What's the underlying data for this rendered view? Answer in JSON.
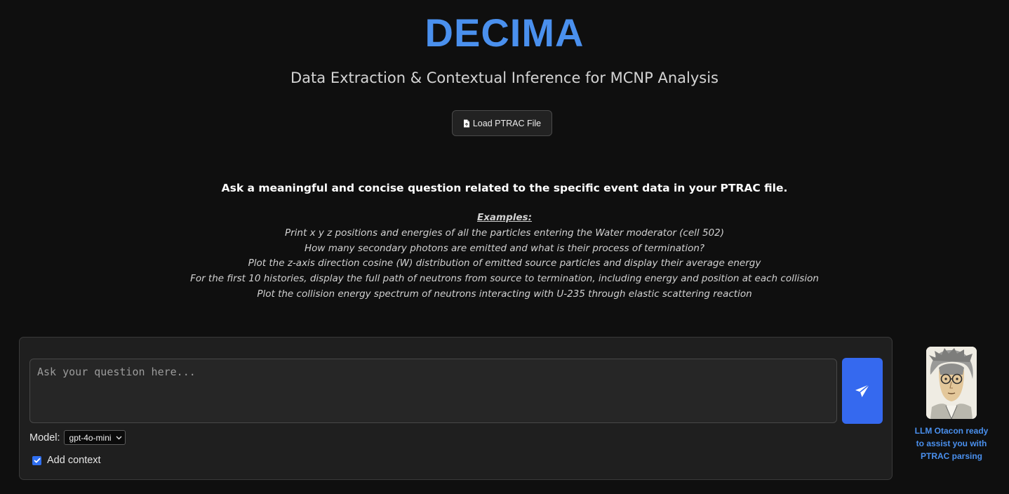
{
  "header": {
    "title": "DECIMA",
    "subtitle": "Data Extraction & Contextual Inference for MCNP Analysis"
  },
  "load_button": {
    "label": "Load PTRAC File",
    "icon": "file-icon"
  },
  "instructions": {
    "text": "Ask a meaningful and concise question related to the specific event data in your PTRAC file.",
    "examples_heading": "Examples:",
    "examples": [
      "Print x y z positions and energies of all the particles entering the Water moderator (cell 502)",
      "How many secondary photons are emitted and what is their process of termination?",
      "Plot the z-axis direction cosine (W) distribution of emitted source particles and display their average energy",
      "For the first 10 histories, display the full path of neutrons from source to termination, including energy and position at each collision",
      "Plot the collision energy spectrum of neutrons interacting with U-235 through elastic scattering reaction"
    ]
  },
  "chat": {
    "placeholder": "Ask your question here...",
    "value": "",
    "send_icon": "paper-plane-icon",
    "model_label": "Model:",
    "model_selected": "gpt-4o-mini",
    "context_label": "Add context",
    "context_checked": true
  },
  "assistant": {
    "status_lines": [
      "LLM Otacon ready",
      "to assist you with",
      "PTRAC parsing"
    ]
  },
  "colors": {
    "background": "#0f0f0f",
    "accent": "#4a90ee",
    "send_button": "#3569ef",
    "panel": "#1f1f1f"
  }
}
